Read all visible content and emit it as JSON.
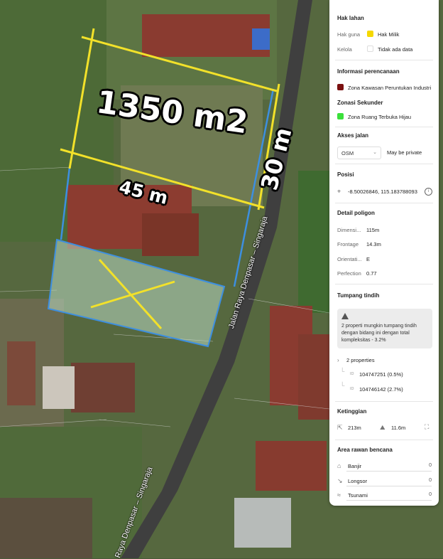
{
  "map": {
    "annotations": {
      "area": "1350 m2",
      "width": "45 m",
      "depth": "30 m"
    },
    "road_name": "Jalan Raya Denpasar – Singaraja",
    "road_name_2": "Raya Denpasar – Singaraja",
    "colors": {
      "measure_line": "#f2e12a",
      "parcel_outline": "#3d8fe0",
      "highlight_fill": "#b9d8c2"
    }
  },
  "panel": {
    "hak_lahan": {
      "title": "Hak lahan",
      "hak_guna_label": "Hak guna",
      "hak_guna_value": "Hak Milik",
      "hak_guna_color": "#f5d800",
      "kelola_label": "Kelola",
      "kelola_value": "Tidak ada data",
      "kelola_color": "#ffffff"
    },
    "perencanaan": {
      "title": "Informasi perencanaan",
      "zona": "Zona Kawasan Peruntukan Industri",
      "zona_color": "#7a1010",
      "sekunder_title": "Zonasi Sekunder",
      "sekunder": "Zona Ruang Terbuka Hijau",
      "sekunder_color": "#3be03b"
    },
    "akses": {
      "title": "Akses jalan",
      "source": "OSM",
      "value": "May be private"
    },
    "posisi": {
      "title": "Posisi",
      "coords": "-8.50026846, 115.183788093"
    },
    "poligon": {
      "title": "Detail poligon",
      "rows": [
        {
          "label": "Dimensi...",
          "value": "115m"
        },
        {
          "label": "Frontage",
          "value": "14.3m"
        },
        {
          "label": "Orientati...",
          "value": "E"
        },
        {
          "label": "Perfection",
          "value": "0.77"
        }
      ]
    },
    "tumpang": {
      "title": "Tumpang tindih",
      "note": "2 properti mungkin tumpang tindih dengan bidang ini dengan total kompleksitas - 3.2%",
      "count_label": "2 properties",
      "items": [
        {
          "id_label": "ID",
          "value": "104747251 (0.5%)"
        },
        {
          "id_label": "ID",
          "value": "104746142 (2.7%)"
        }
      ]
    },
    "ketinggian": {
      "title": "Ketinggian",
      "elevation": "213m",
      "height": "11.6m"
    },
    "bencana": {
      "title": "Area rawan bencana",
      "items": [
        {
          "label": "Banjir",
          "value": "0"
        },
        {
          "label": "Longsor",
          "value": "0"
        },
        {
          "label": "Tsunami",
          "value": "0"
        }
      ]
    }
  }
}
